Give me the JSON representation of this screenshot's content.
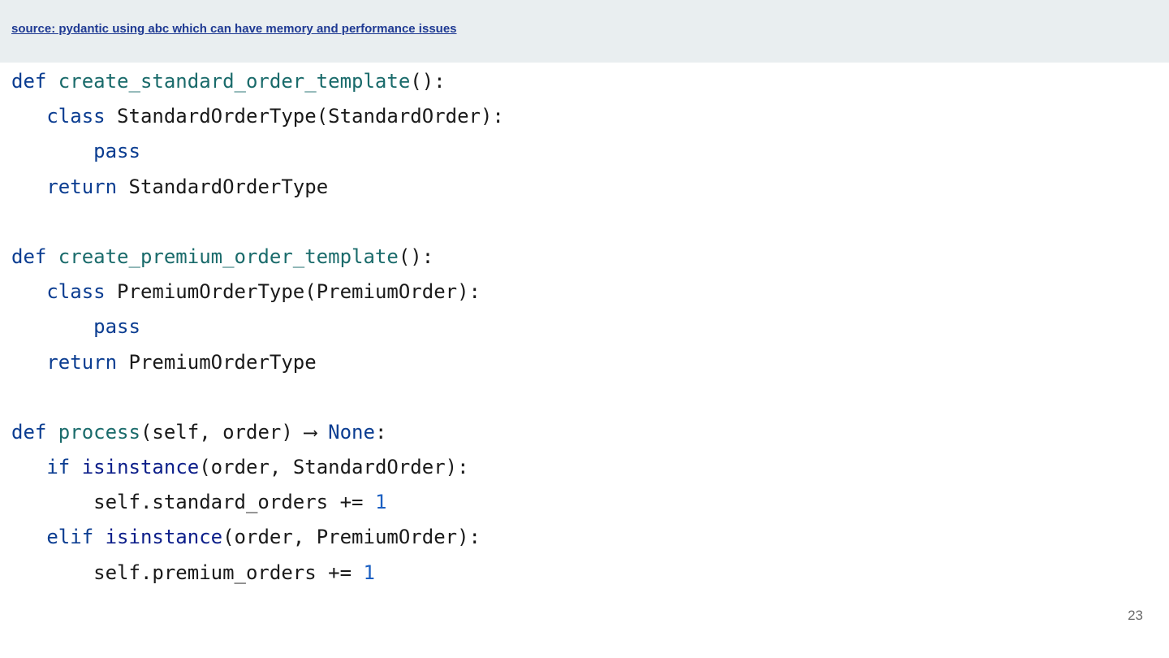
{
  "header": {
    "source_link": "source: pydantic using abc which can have memory and performance issues"
  },
  "colors": {
    "header_bg": "#e9eef0",
    "keyword": "#0b3d91",
    "function_name": "#1a6b6b",
    "builtin": "#0d1f8a",
    "number": "#1b5fc2",
    "link": "#1f3a93"
  },
  "code": {
    "lines": [
      [
        {
          "t": "def ",
          "c": "kw"
        },
        {
          "t": "create_standard_order_template",
          "c": "fn"
        },
        {
          "t": "():",
          "c": "plain"
        }
      ],
      [
        {
          "t": "   ",
          "c": "plain"
        },
        {
          "t": "class",
          "c": "kw"
        },
        {
          "t": " StandardOrderType(StandardOrder):",
          "c": "plain"
        }
      ],
      [
        {
          "t": "       ",
          "c": "plain"
        },
        {
          "t": "pass",
          "c": "kw"
        }
      ],
      [
        {
          "t": "   ",
          "c": "plain"
        },
        {
          "t": "return",
          "c": "kw"
        },
        {
          "t": " StandardOrderType",
          "c": "plain"
        }
      ],
      [],
      [
        {
          "t": "def ",
          "c": "kw"
        },
        {
          "t": "create_premium_order_template",
          "c": "fn"
        },
        {
          "t": "():",
          "c": "plain"
        }
      ],
      [
        {
          "t": "   ",
          "c": "plain"
        },
        {
          "t": "class",
          "c": "kw"
        },
        {
          "t": " PremiumOrderType(PremiumOrder):",
          "c": "plain"
        }
      ],
      [
        {
          "t": "       ",
          "c": "plain"
        },
        {
          "t": "pass",
          "c": "kw"
        }
      ],
      [
        {
          "t": "   ",
          "c": "plain"
        },
        {
          "t": "return",
          "c": "kw"
        },
        {
          "t": " PremiumOrderType",
          "c": "plain"
        }
      ],
      [],
      [
        {
          "t": "def ",
          "c": "kw"
        },
        {
          "t": "process",
          "c": "fn"
        },
        {
          "t": "(self, order) ⟶ ",
          "c": "plain"
        },
        {
          "t": "None",
          "c": "kw"
        },
        {
          "t": ":",
          "c": "plain"
        }
      ],
      [
        {
          "t": "   ",
          "c": "plain"
        },
        {
          "t": "if",
          "c": "kw"
        },
        {
          "t": " ",
          "c": "plain"
        },
        {
          "t": "isinstance",
          "c": "bi"
        },
        {
          "t": "(order, StandardOrder):",
          "c": "plain"
        }
      ],
      [
        {
          "t": "       self.standard_orders += ",
          "c": "plain"
        },
        {
          "t": "1",
          "c": "num"
        }
      ],
      [
        {
          "t": "   ",
          "c": "plain"
        },
        {
          "t": "elif",
          "c": "kw"
        },
        {
          "t": " ",
          "c": "plain"
        },
        {
          "t": "isinstance",
          "c": "bi"
        },
        {
          "t": "(order, PremiumOrder):",
          "c": "plain"
        }
      ],
      [
        {
          "t": "       self.premium_orders += ",
          "c": "plain"
        },
        {
          "t": "1",
          "c": "num"
        }
      ]
    ]
  },
  "footer": {
    "page_number": "23"
  }
}
